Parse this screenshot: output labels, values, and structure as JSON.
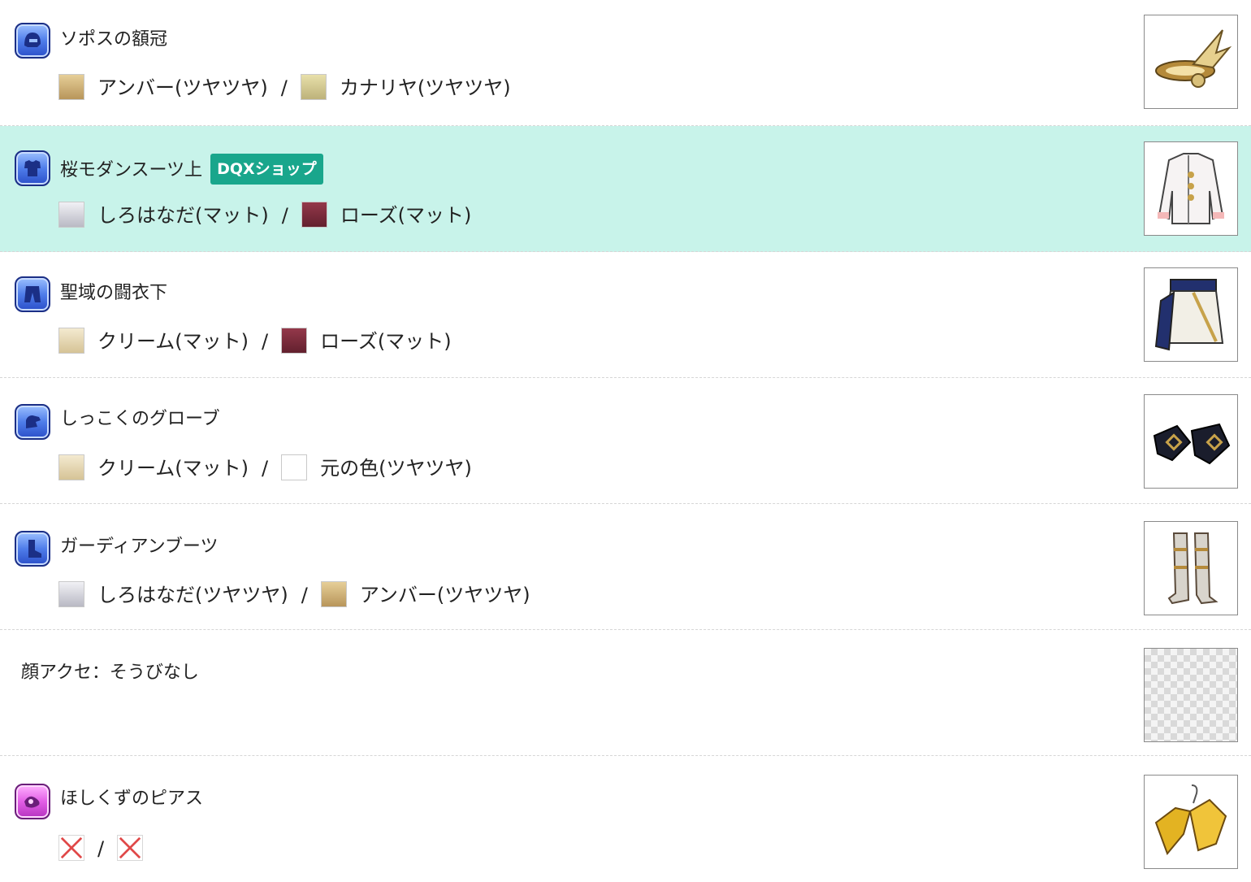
{
  "items": [
    {
      "slot_icon": "head-slot-icon",
      "name": "ソポスの額冠",
      "color1": {
        "swatch": "#c9a86a",
        "label": "アンバー(ツヤツヤ)"
      },
      "separator": "/",
      "color2": {
        "swatch": "#c9c08a",
        "label": "カナリヤ(ツヤツヤ)"
      },
      "thumbnail": "winged-circlet-icon"
    },
    {
      "slot_icon": "body-top-slot-icon",
      "name": "桜モダンスーツ上",
      "badge": "DQXショップ",
      "highlighted": true,
      "color1": {
        "swatch": "#d8d8df",
        "label": "しろはなだ(マット)"
      },
      "separator": "/",
      "color2": {
        "swatch": "#7a2838",
        "label": "ローズ(マット)"
      },
      "thumbnail": "white-suit-jacket-icon"
    },
    {
      "slot_icon": "body-bottom-slot-icon",
      "name": "聖域の闘衣下",
      "color1": {
        "swatch": "#e8d9b6",
        "label": "クリーム(マット)"
      },
      "separator": "/",
      "color2": {
        "swatch": "#7a2838",
        "label": "ローズ(マット)"
      },
      "thumbnail": "skirt-icon"
    },
    {
      "slot_icon": "arm-slot-icon",
      "name": "しっこくのグローブ",
      "color1": {
        "swatch": "#e8d9b6",
        "label": "クリーム(マット)"
      },
      "separator": "/",
      "color2": {
        "swatch": "#ffffff",
        "label": "元の色(ツヤツヤ)"
      },
      "thumbnail": "black-gloves-icon"
    },
    {
      "slot_icon": "leg-slot-icon",
      "name": "ガーディアンブーツ",
      "color1": {
        "swatch": "#d8d8df",
        "label": "しろはなだ(ツヤツヤ)"
      },
      "separator": "/",
      "color2": {
        "swatch": "#c9a86a",
        "label": "アンバー(ツヤツヤ)"
      },
      "thumbnail": "armored-boots-icon"
    },
    {
      "text": "顔アクセ：そうびなし",
      "thumbnail": "empty-slot-checker-icon"
    },
    {
      "slot_icon": "accessory-slot-icon",
      "name": "ほしくずのピアス",
      "separator": "/",
      "color1": {
        "swatch": "none",
        "label": ""
      },
      "color2": {
        "swatch": "none",
        "label": ""
      },
      "thumbnail": "star-earrings-icon"
    }
  ]
}
